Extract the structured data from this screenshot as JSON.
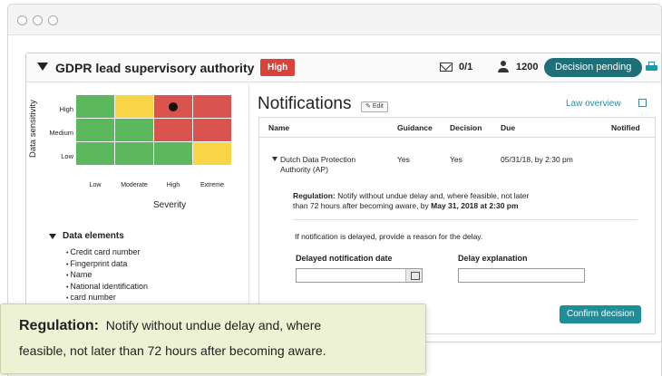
{
  "header": {
    "title": "GDPR lead supervisory authority",
    "risk_badge": "High",
    "mail_count": "0/1",
    "user_count": "1200",
    "status_pill": "Decision pending"
  },
  "risk_matrix": {
    "y_axis_label": "Data sensitivity",
    "x_axis_label": "Severity",
    "rows": [
      "High",
      "Medium",
      "Low"
    ],
    "columns": [
      "Low",
      "Moderate",
      "High",
      "Extreme"
    ],
    "colors": {
      "green": "#5cb85c",
      "yellow": "#f8d546",
      "red": "#d9534f"
    },
    "cells": [
      [
        "green",
        "yellow",
        "red",
        "red"
      ],
      [
        "green",
        "green",
        "red",
        "red"
      ],
      [
        "green",
        "green",
        "green",
        "yellow"
      ]
    ],
    "marker": {
      "row": "High",
      "column": "High"
    }
  },
  "data_elements": {
    "title": "Data elements",
    "items": [
      "Credit card number",
      "Fingerprint data",
      "Name",
      "National identification",
      "card number"
    ]
  },
  "notifications": {
    "title": "Notifications",
    "edit_label": "Edit",
    "law_link": "Law overview",
    "columns": [
      "Name",
      "Guidance",
      "Decision",
      "Due",
      "Notified"
    ],
    "row": {
      "name_line1": "Dutch Data Protection",
      "name_line2": "Authority (AP)",
      "guidance": "Yes",
      "decision": "Yes",
      "due": "05/31/18, by 2:30 pm"
    },
    "regulation_label": "Regulation:",
    "regulation_text1": " Notify without undue delay and, where feasible, not later",
    "regulation_text2": "than 72 hours after becoming aware, by ",
    "regulation_deadline": "May 31, 2018 at 2:30 pm",
    "delay_note": "If notification is delayed, provide a reason for the delay.",
    "delayed_date_label": "Delayed notification date",
    "delay_explanation_label": "Delay explanation",
    "confirm_label": "Confirm decision"
  },
  "tooltip": {
    "head": "Regulation:",
    "line1_rest": "Notify without undue delay and, where",
    "line2": "feasible, not later than 72 hours after becoming aware."
  }
}
